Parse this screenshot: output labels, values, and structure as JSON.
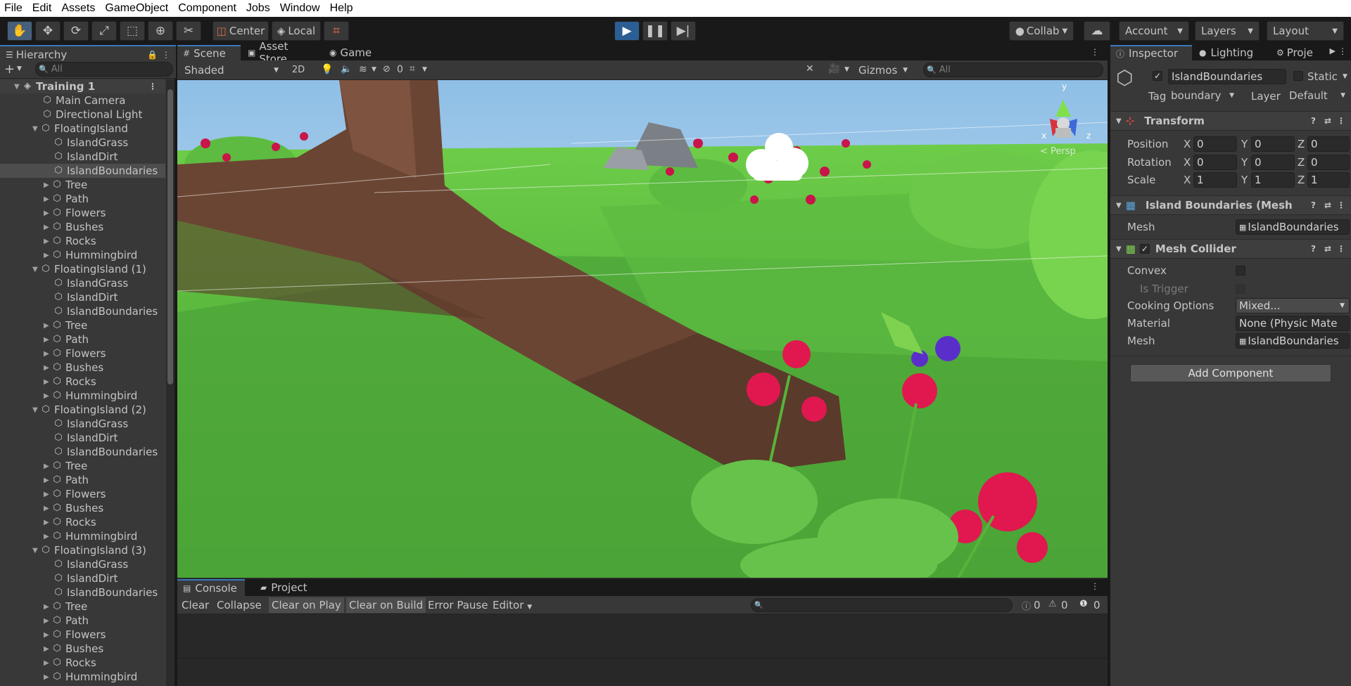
{
  "menu": [
    "File",
    "Edit",
    "Assets",
    "GameObject",
    "Component",
    "Jobs",
    "Window",
    "Help"
  ],
  "toolbar": {
    "pivot_label": "Center",
    "space_label": "Local",
    "collab_label": "Collab",
    "account_label": "Account",
    "layers_label": "Layers",
    "layout_label": "Layout"
  },
  "hierarchy": {
    "tab_label": "Hierarchy",
    "search_placeholder": "All",
    "rows": [
      {
        "label": "Training 1",
        "indent": 0,
        "kind": "scene"
      },
      {
        "label": "Main Camera",
        "indent": 1,
        "kind": "obj"
      },
      {
        "label": "Directional Light",
        "indent": 1,
        "kind": "obj"
      },
      {
        "label": "FloatingIsland",
        "indent": 1,
        "kind": "group"
      },
      {
        "label": "IslandGrass",
        "indent": 2,
        "kind": "obj"
      },
      {
        "label": "IslandDirt",
        "indent": 2,
        "kind": "obj"
      },
      {
        "label": "IslandBoundaries",
        "indent": 2,
        "kind": "obj",
        "selected": true
      },
      {
        "label": "Tree",
        "indent": 2,
        "kind": "child"
      },
      {
        "label": "Path",
        "indent": 2,
        "kind": "child"
      },
      {
        "label": "Flowers",
        "indent": 2,
        "kind": "child"
      },
      {
        "label": "Bushes",
        "indent": 2,
        "kind": "child"
      },
      {
        "label": "Rocks",
        "indent": 2,
        "kind": "child"
      },
      {
        "label": "Hummingbird",
        "indent": 2,
        "kind": "child"
      },
      {
        "label": "FloatingIsland (1)",
        "indent": 1,
        "kind": "group"
      },
      {
        "label": "IslandGrass",
        "indent": 2,
        "kind": "obj"
      },
      {
        "label": "IslandDirt",
        "indent": 2,
        "kind": "obj"
      },
      {
        "label": "IslandBoundaries",
        "indent": 2,
        "kind": "obj"
      },
      {
        "label": "Tree",
        "indent": 2,
        "kind": "child"
      },
      {
        "label": "Path",
        "indent": 2,
        "kind": "child"
      },
      {
        "label": "Flowers",
        "indent": 2,
        "kind": "child"
      },
      {
        "label": "Bushes",
        "indent": 2,
        "kind": "child"
      },
      {
        "label": "Rocks",
        "indent": 2,
        "kind": "child"
      },
      {
        "label": "Hummingbird",
        "indent": 2,
        "kind": "child"
      },
      {
        "label": "FloatingIsland (2)",
        "indent": 1,
        "kind": "group"
      },
      {
        "label": "IslandGrass",
        "indent": 2,
        "kind": "obj"
      },
      {
        "label": "IslandDirt",
        "indent": 2,
        "kind": "obj"
      },
      {
        "label": "IslandBoundaries",
        "indent": 2,
        "kind": "obj"
      },
      {
        "label": "Tree",
        "indent": 2,
        "kind": "child"
      },
      {
        "label": "Path",
        "indent": 2,
        "kind": "child"
      },
      {
        "label": "Flowers",
        "indent": 2,
        "kind": "child"
      },
      {
        "label": "Bushes",
        "indent": 2,
        "kind": "child"
      },
      {
        "label": "Rocks",
        "indent": 2,
        "kind": "child"
      },
      {
        "label": "Hummingbird",
        "indent": 2,
        "kind": "child"
      },
      {
        "label": "FloatingIsland (3)",
        "indent": 1,
        "kind": "group"
      },
      {
        "label": "IslandGrass",
        "indent": 2,
        "kind": "obj"
      },
      {
        "label": "IslandDirt",
        "indent": 2,
        "kind": "obj"
      },
      {
        "label": "IslandBoundaries",
        "indent": 2,
        "kind": "obj"
      },
      {
        "label": "Tree",
        "indent": 2,
        "kind": "child"
      },
      {
        "label": "Path",
        "indent": 2,
        "kind": "child"
      },
      {
        "label": "Flowers",
        "indent": 2,
        "kind": "child"
      },
      {
        "label": "Bushes",
        "indent": 2,
        "kind": "child"
      },
      {
        "label": "Rocks",
        "indent": 2,
        "kind": "child"
      },
      {
        "label": "Hummingbird",
        "indent": 2,
        "kind": "child"
      }
    ]
  },
  "scene": {
    "tabs": [
      "Scene",
      "Asset Store",
      "Game"
    ],
    "shading_mode": "Shaded",
    "mode_2d": "2D",
    "hidden_count": "0",
    "gizmos_label": "Gizmos",
    "search_placeholder": "All",
    "persp_label": "< Persp",
    "axis_y": "y",
    "axis_x": "x",
    "axis_z": "z"
  },
  "console": {
    "tabs": [
      "Console",
      "Project"
    ],
    "buttons": [
      "Clear",
      "Collapse",
      "Clear on Play",
      "Clear on Build",
      "Error Pause",
      "Editor"
    ],
    "info_count": "0",
    "warn_count": "0",
    "error_count": "0"
  },
  "inspector": {
    "tabs": [
      "Inspector",
      "Lighting",
      "Proje"
    ],
    "object_name": "IslandBoundaries",
    "static_label": "Static",
    "tag_label": "Tag",
    "tag_value": "boundary",
    "layer_label": "Layer",
    "layer_value": "Default",
    "transform": {
      "title": "Transform",
      "position_label": "Position",
      "rotation_label": "Rotation",
      "scale_label": "Scale",
      "position": [
        "0",
        "0",
        "0"
      ],
      "rotation": [
        "0",
        "0",
        "0"
      ],
      "scale": [
        "1",
        "1",
        "1"
      ]
    },
    "mesh_filter": {
      "title": "Island Boundaries (Mesh",
      "mesh_label": "Mesh",
      "mesh_value": "IslandBoundaries"
    },
    "mesh_collider": {
      "title": "Mesh Collider",
      "convex_label": "Convex",
      "is_trigger_label": "Is Trigger",
      "cooking_label": "Cooking Options",
      "cooking_value": "Mixed...",
      "material_label": "Material",
      "material_value": "None (Physic Mate",
      "mesh_label": "Mesh",
      "mesh_value": "IslandBoundaries"
    },
    "add_component_label": "Add Component"
  }
}
